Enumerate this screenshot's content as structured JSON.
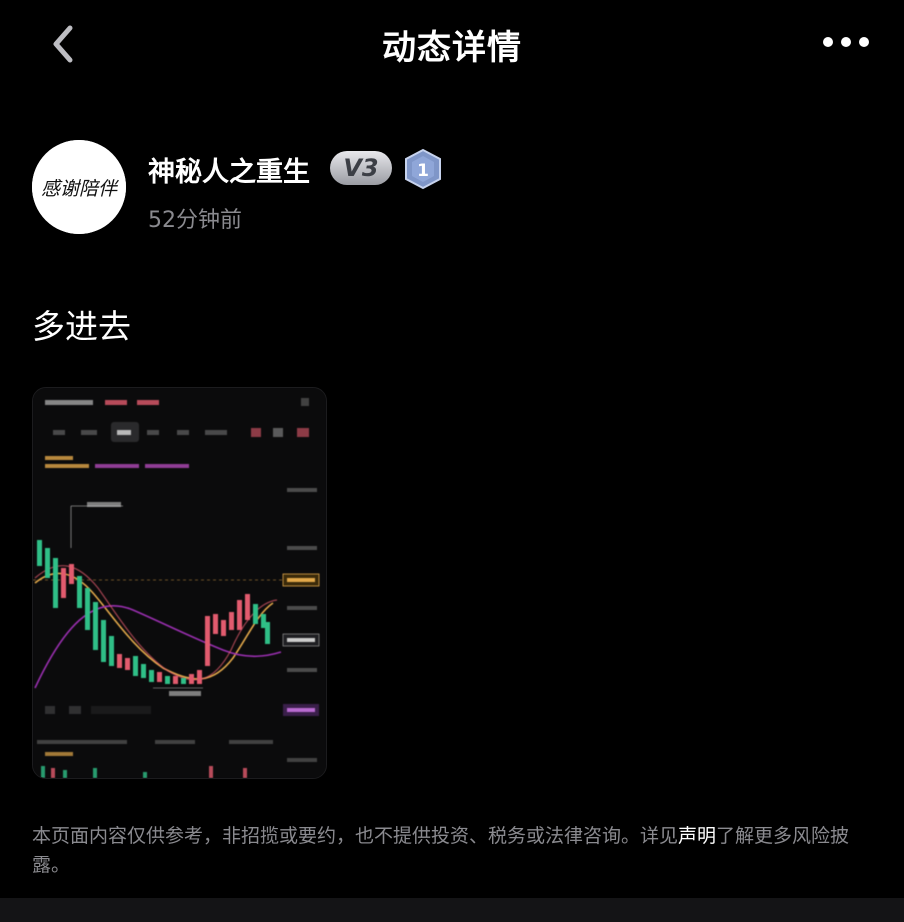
{
  "header": {
    "title": "动态详情",
    "back_icon": "chevron-left-icon",
    "more_icon": "more-horizontal-icon"
  },
  "author": {
    "avatar_text": "感谢陪伴",
    "name": "神秘人之重生",
    "vip_label": "V3",
    "level": "1",
    "time": "52分钟前"
  },
  "post": {
    "text": "多进去"
  },
  "disclaimer": {
    "before": "本页面内容仅供参考，非招揽或要约，也不提供投资、税务或法律咨询。详见",
    "link": "声明",
    "after": "了解更多风险披露。"
  },
  "colors": {
    "background": "#000000",
    "up": "#e25b6e",
    "down": "#2fbf87",
    "muted": "#8a8a8f"
  }
}
